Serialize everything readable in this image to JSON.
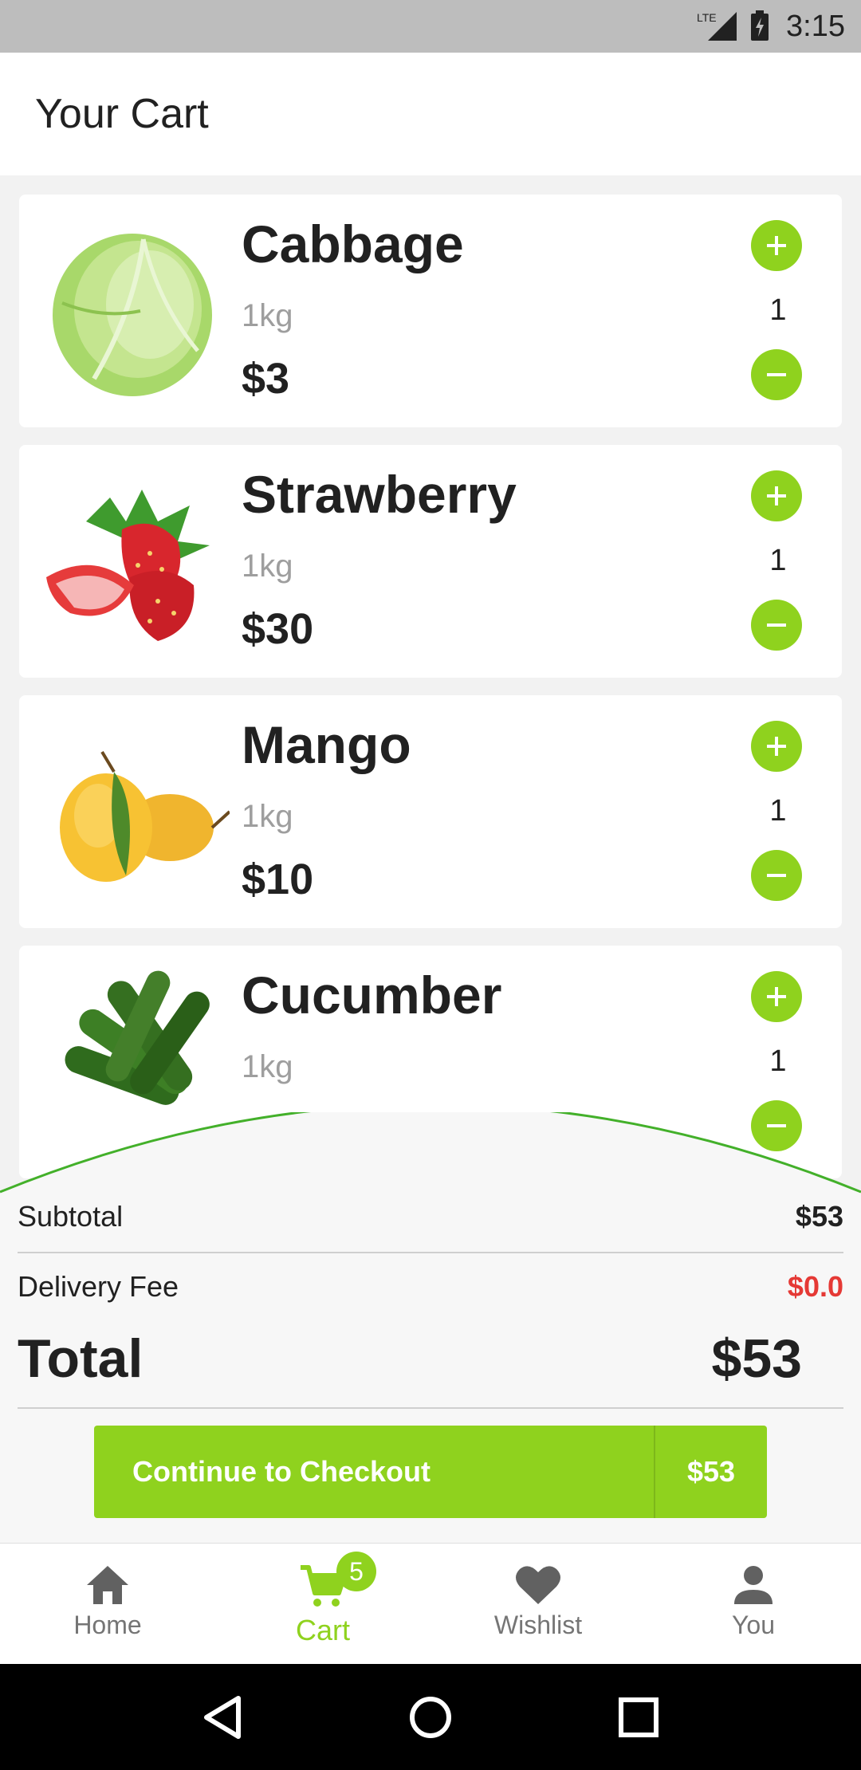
{
  "status_bar": {
    "network": "LTE",
    "time": "3:15"
  },
  "app_bar": {
    "title": "Your Cart"
  },
  "cart": {
    "items": [
      {
        "name": "Cabbage",
        "unit": "1kg",
        "price": "$3",
        "qty": "1"
      },
      {
        "name": "Strawberry",
        "unit": "1kg",
        "price": "$30",
        "qty": "1"
      },
      {
        "name": "Mango",
        "unit": "1kg",
        "price": "$10",
        "qty": "1"
      },
      {
        "name": "Cucumber",
        "unit": "1kg",
        "price": "",
        "qty": "1"
      }
    ]
  },
  "summary": {
    "subtotal_label": "Subtotal",
    "subtotal_value": "$53",
    "delivery_label": "Delivery Fee",
    "delivery_value": "$0.0",
    "total_label": "Total",
    "total_value": "$53"
  },
  "checkout": {
    "label": "Continue to Checkout",
    "amount": "$53"
  },
  "bottom_nav": {
    "items": [
      {
        "label": "Home"
      },
      {
        "label": "Cart",
        "badge": "5"
      },
      {
        "label": "Wishlist"
      },
      {
        "label": "You"
      }
    ]
  },
  "colors": {
    "accent": "#8fd21e",
    "danger": "#e53935",
    "curve": "#43b02a"
  }
}
